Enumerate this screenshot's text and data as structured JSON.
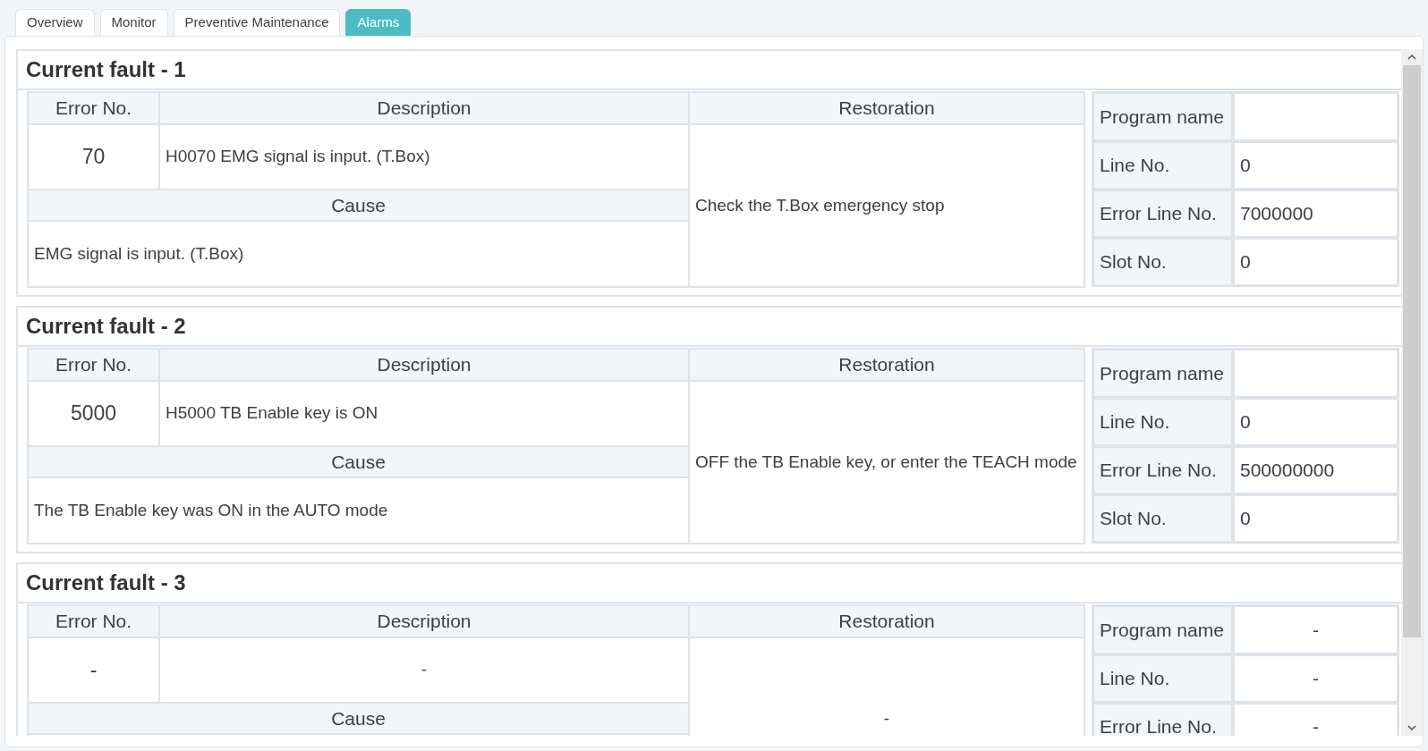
{
  "tabs": [
    {
      "label": "Overview",
      "selected": false
    },
    {
      "label": "Monitor",
      "selected": false
    },
    {
      "label": "Preventive Maintenance",
      "selected": false
    },
    {
      "label": "Alarms",
      "selected": true
    }
  ],
  "faults": [
    {
      "title": "Current fault - 1",
      "headers": {
        "error_no": "Error No.",
        "description": "Description",
        "restoration": "Restoration",
        "cause": "Cause"
      },
      "error_no": "70",
      "description": "H0070 EMG signal is input. (T.Box)",
      "restoration": "Check the T.Box emergency stop",
      "cause": "EMG signal is input. (T.Box)",
      "center_values": false,
      "details": [
        {
          "label": "Program name"
        },
        {
          "label": "Line No.",
          "value": "0"
        },
        {
          "label": "Error Line No.",
          "value": "7000000"
        },
        {
          "label": "Slot No.",
          "value": "0"
        }
      ]
    },
    {
      "title": "Current fault - 2",
      "headers": {
        "error_no": "Error No.",
        "description": "Description",
        "restoration": "Restoration",
        "cause": "Cause"
      },
      "error_no": "5000",
      "description": "H5000 TB Enable key is ON",
      "restoration": "OFF the TB Enable key, or enter the TEACH mode",
      "cause": "The TB Enable key was ON in the AUTO mode",
      "center_values": false,
      "details": [
        {
          "label": "Program name"
        },
        {
          "label": "Line No.",
          "value": "0"
        },
        {
          "label": "Error Line No.",
          "value": "500000000"
        },
        {
          "label": "Slot No.",
          "value": "0"
        }
      ]
    },
    {
      "title": "Current fault - 3",
      "headers": {
        "error_no": "Error No.",
        "description": "Description",
        "restoration": "Restoration",
        "cause": "Cause"
      },
      "error_no": "-",
      "description": "-",
      "restoration": "-",
      "center_values": true,
      "details": [
        {
          "label": "Program name",
          "value": "-"
        },
        {
          "label": "Line No.",
          "value": "-"
        },
        {
          "label": "Error Line No.",
          "value": "-"
        }
      ]
    }
  ]
}
